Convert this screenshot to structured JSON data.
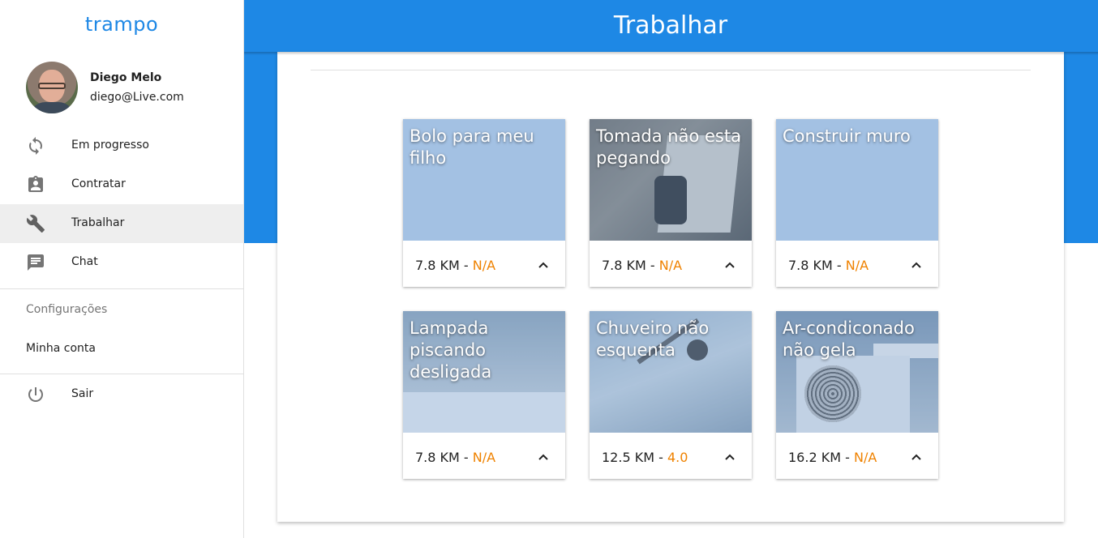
{
  "app": {
    "brand": "trampo",
    "page_title": "Trabalhar",
    "accent_color": "#1e88e5",
    "rating_color": "#ef8200"
  },
  "user": {
    "name": "Diego Melo",
    "email": "diego@Live.com"
  },
  "nav": {
    "items": [
      {
        "label": "Em progresso",
        "icon": "sync-icon"
      },
      {
        "label": "Contratar",
        "icon": "assignment-ind-icon"
      },
      {
        "label": "Trabalhar",
        "icon": "wrench-icon",
        "active": true
      },
      {
        "label": "Chat",
        "icon": "chat-icon"
      }
    ],
    "settings_header": "Configurações",
    "account_label": "Minha conta",
    "logout_label": "Sair",
    "logout_icon": "power-icon"
  },
  "jobs": [
    {
      "title": "Bolo para meu filho",
      "distance": "7.8 KM",
      "separator": " - ",
      "rating": "N/A",
      "has_photo": false
    },
    {
      "title": "Tomada não esta pegando",
      "distance": "7.8 KM",
      "separator": " - ",
      "rating": "N/A",
      "has_photo": true,
      "photo": "plug"
    },
    {
      "title": "Construir muro",
      "distance": "7.8 KM",
      "separator": " - ",
      "rating": "N/A",
      "has_photo": false
    },
    {
      "title": "Lampada piscando desligada",
      "distance": "7.8 KM",
      "separator": " - ",
      "rating": "N/A",
      "has_photo": true,
      "photo": "ceiling"
    },
    {
      "title": "Chuveiro não esquenta",
      "distance": "12.5 KM",
      "separator": " - ",
      "rating": "4.0",
      "has_photo": true,
      "photo": "shower"
    },
    {
      "title": "Ar-condiconado não gela",
      "distance": "16.2 KM",
      "separator": " - ",
      "rating": "N/A",
      "has_photo": true,
      "photo": "ac"
    }
  ]
}
